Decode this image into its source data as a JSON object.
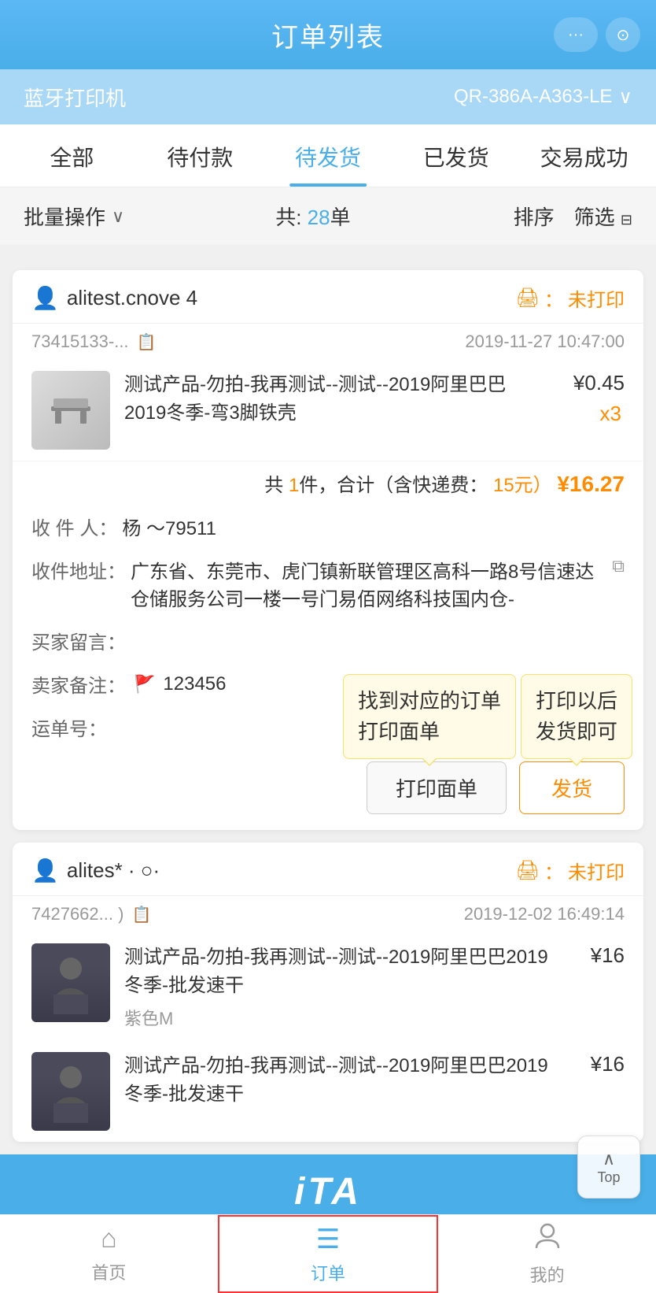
{
  "header": {
    "title": "订单列表",
    "more_btn": "···",
    "scan_btn": "⊙"
  },
  "bluetooth": {
    "label": "蓝牙打印机",
    "device": "QR-386A-A363-LE",
    "chevron": "∨"
  },
  "tabs": [
    {
      "label": "全部",
      "active": false
    },
    {
      "label": "待付款",
      "active": false
    },
    {
      "label": "待发货",
      "active": true
    },
    {
      "label": "已发货",
      "active": false
    },
    {
      "label": "交易成功",
      "active": false
    }
  ],
  "toolbar": {
    "batch_ops": "批量操作",
    "count_text": "共: 28单",
    "count_number": "28",
    "sort": "排序",
    "filter": "筛选"
  },
  "order1": {
    "username": "alitest.cnove 4",
    "order_num": "73415133-...",
    "print_status": "未打印",
    "date": "2019-11-27 10:47:00",
    "product_name": "测试产品-勿拍-我再测试--测试--2019阿里巴巴2019冬季-弯3脚铁壳",
    "price": "¥0.45",
    "qty": "x3",
    "total_text": "共 1件，合计（含快递费：",
    "shipping": "15元）",
    "total": "¥16.27",
    "receiver_label": "收 件 人：",
    "receiver": "杨         ～79511",
    "address_label": "收件地址：",
    "address": "广东省、东莞市、虎门镇新联管理区高科一路8号信速达仓储服务公司一楼一号门易佰网络科技国内仓-",
    "buyer_remark_label": "买家留言：",
    "buyer_remark": "",
    "seller_remark_label": "卖家备注：",
    "seller_remark": "123456",
    "tracking_label": "运单号：",
    "btn_print": "打印面单",
    "btn_ship": "发货",
    "tooltip_print": "找到对应的订单\n打印面单",
    "tooltip_ship": "打印以后\n发货即可"
  },
  "order2": {
    "username": "alites*  ·  ○·",
    "order_num": "7427662...  )",
    "print_status": "未打印",
    "date": "2019-12-02 16:49:14",
    "product1_name": "测试产品-勿拍-我再测试--测试--2019阿里巴巴2019冬季-批发速干",
    "product1_variant": "紫色M",
    "product1_price": "¥16",
    "product2_name": "测试产品-勿拍-我再测试--测试--2019阿里巴巴2019冬季-批发速干",
    "product2_price": "¥16"
  },
  "top_btn": {
    "arrow": "∧",
    "label": "Top"
  },
  "bottom_nav": {
    "home_icon": "⌂",
    "home_label": "首页",
    "order_icon": "☰",
    "order_label": "订单",
    "my_icon": "○",
    "my_label": "我的"
  },
  "ita": {
    "text": "iTA"
  }
}
